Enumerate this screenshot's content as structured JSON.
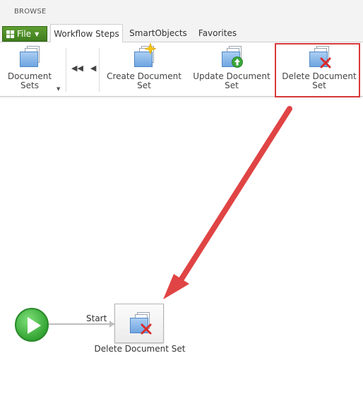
{
  "topbar": {
    "browse": "BROWSE"
  },
  "tabs": {
    "file": "File",
    "items": [
      "Workflow Steps",
      "SmartObjects",
      "Favorites"
    ]
  },
  "ribbon": {
    "document_sets": {
      "line1": "Document",
      "line2": "Sets"
    },
    "create": {
      "line1": "Create Document",
      "line2": "Set"
    },
    "update": {
      "line1": "Update Document",
      "line2": "Set"
    },
    "delete": {
      "line1": "Delete Document",
      "line2": "Set"
    }
  },
  "canvas": {
    "start_label": "Start",
    "step_label": "Delete Document Set"
  },
  "colors": {
    "file_green": "#4a8c25",
    "highlight_red": "#d9383a",
    "start_green": "#34a534"
  }
}
